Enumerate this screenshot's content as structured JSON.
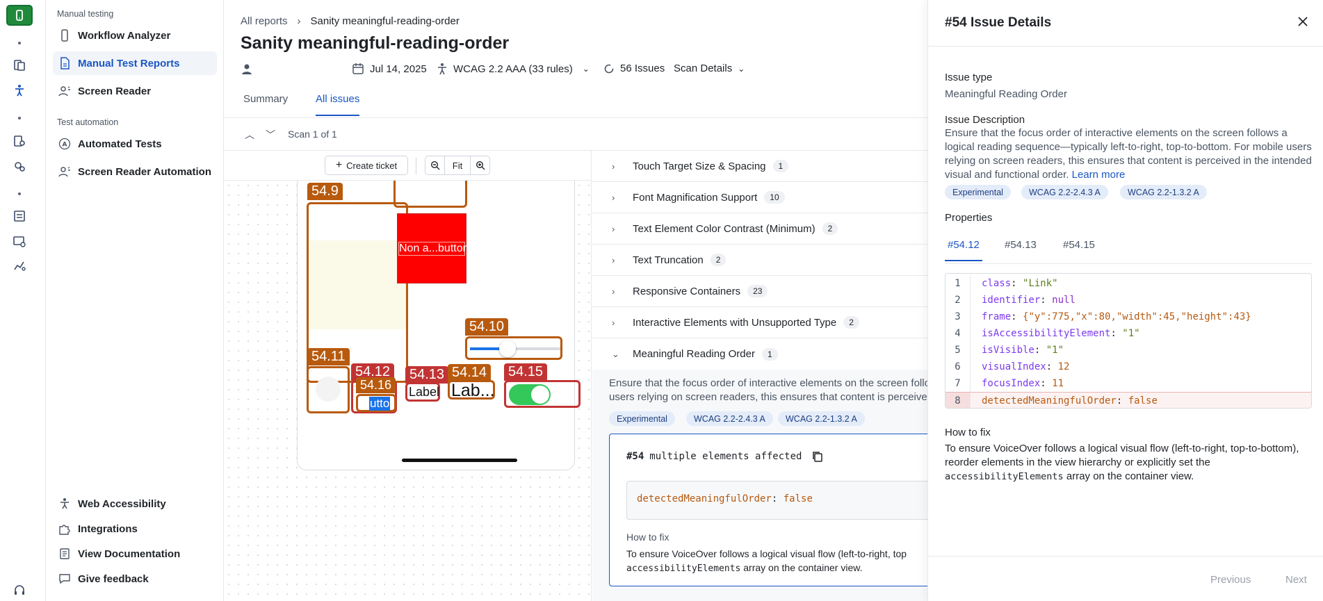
{
  "sidebar": {
    "section_manual": "Manual testing",
    "section_auto": "Test automation",
    "items": [
      {
        "label": "Workflow Analyzer"
      },
      {
        "label": "Manual Test Reports"
      },
      {
        "label": "Screen Reader"
      },
      {
        "label": "Automated Tests"
      },
      {
        "label": "Screen Reader Automation"
      }
    ],
    "bottom": [
      {
        "label": "Web Accessibility"
      },
      {
        "label": "Integrations"
      },
      {
        "label": "View Documentation"
      },
      {
        "label": "Give feedback"
      }
    ]
  },
  "header": {
    "breadcrumb_root": "All reports",
    "breadcrumb_current": "Sanity meaningful-reading-order",
    "title": "Sanity meaningful-reading-order",
    "date": "Jul 14, 2025",
    "standard": "WCAG 2.2 AAA (33 rules)",
    "issues_count": "56 Issues",
    "scan_details": "Scan Details"
  },
  "tabs": {
    "summary": "Summary",
    "all_issues": "All issues"
  },
  "scan": {
    "label": "Scan 1 of 1"
  },
  "toolbar": {
    "create_ticket": "Create ticket",
    "fit": "Fit"
  },
  "overlay": {
    "labels": [
      "54.9",
      "54.10",
      "54.11",
      "54.12",
      "54.13",
      "54.14",
      "54.15",
      "54.16"
    ],
    "red_button": "Non a...button",
    "label1": "Label",
    "label2": "Lab...",
    "mini_btn": "utto"
  },
  "groups": [
    {
      "name": "Touch Target Size & Spacing",
      "count": "1"
    },
    {
      "name": "Font Magnification Support",
      "count": "10"
    },
    {
      "name": "Text Element Color Contrast (Minimum)",
      "count": "2"
    },
    {
      "name": "Text Truncation",
      "count": "2"
    },
    {
      "name": "Responsive Containers",
      "count": "23"
    },
    {
      "name": "Interactive Elements with Unsupported Type",
      "count": "2"
    },
    {
      "name": "Meaningful Reading Order",
      "count": "1"
    }
  ],
  "expanded": {
    "desc_line1": "Ensure that the focus order of interactive elements on the screen follo",
    "desc_line2": "users relying on screen readers, this ensures that content is perceive",
    "tags": [
      "Experimental",
      "WCAG 2.2-2.4.3 A",
      "WCAG 2.2-1.3.2 A"
    ],
    "card_id": "#54",
    "card_title": "multiple elements affected",
    "code_key": "detectedMeaningfulOrder",
    "code_val": "false",
    "howto_h": "How to fix",
    "howto_l1": "To ensure VoiceOver follows a logical visual flow (left-to-right, top",
    "howto_code": "accessibilityElements",
    "howto_l2": "array on the container view."
  },
  "panel": {
    "title": "#54 Issue Details",
    "issue_type_h": "Issue type",
    "issue_type": "Meaningful Reading Order",
    "desc_h": "Issue Description",
    "desc": "Ensure that the focus order of interactive elements on the screen follows a logical reading sequence—typically left-to-right, top-to-bottom. For mobile users relying on screen readers, this ensures that content is perceived in the intended visual and functional order.",
    "learn_more": "Learn more",
    "tags": [
      "Experimental",
      "WCAG 2.2-2.4.3 A",
      "WCAG 2.2-1.3.2 A"
    ],
    "props_h": "Properties",
    "prop_tabs": [
      "#54.12",
      "#54.13",
      "#54.15"
    ],
    "code_lines": [
      {
        "n": "1",
        "k": "class",
        "v": "\"Link\""
      },
      {
        "n": "2",
        "k": "identifier",
        "v": "null"
      },
      {
        "n": "3",
        "k": "frame",
        "v": "{\"y\":775,\"x\":80,\"width\":45,\"height\":43}"
      },
      {
        "n": "4",
        "k": "isAccessibilityElement",
        "v": "\"1\""
      },
      {
        "n": "5",
        "k": "isVisible",
        "v": "\"1\""
      },
      {
        "n": "6",
        "k": "visualIndex",
        "v": "12"
      },
      {
        "n": "7",
        "k": "focusIndex",
        "v": "11"
      },
      {
        "n": "8",
        "k": "detectedMeaningfulOrder",
        "v": "false"
      }
    ],
    "fix_h": "How to fix",
    "fix_l1": "To ensure VoiceOver follows a logical visual flow (left-to-right, top-to-bottom),",
    "fix_l2": "reorder elements in the view hierarchy or explicitly set the",
    "fix_code": "accessibilityElements",
    "fix_l3": "array on the container view.",
    "prev": "Previous",
    "next": "Next"
  }
}
